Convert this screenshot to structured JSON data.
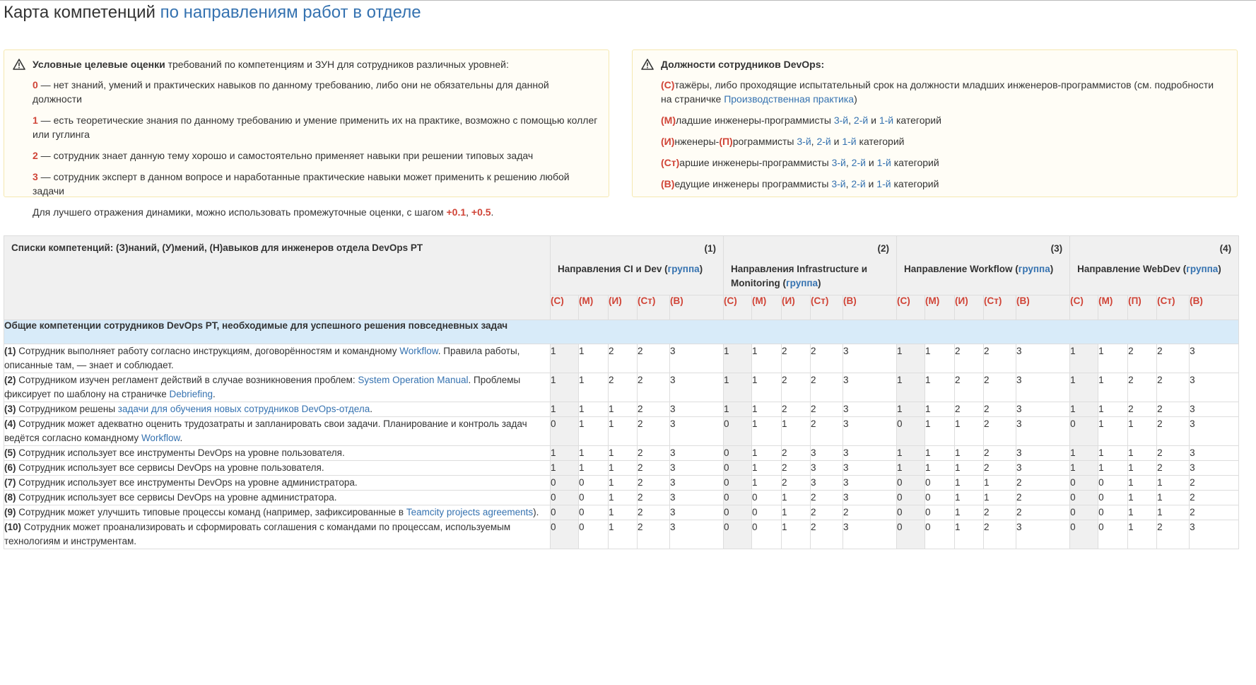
{
  "page": {
    "title_prefix": "Карта компетенций",
    "title_link": "по направлениям работ в отделе"
  },
  "colors": {
    "link": "#3572b0",
    "accent_red": "#d04437",
    "panel_bg": "#fffdf6",
    "section_bg": "#d8ebf9",
    "header_bg": "#f0f0f0"
  },
  "left_panel": {
    "icon": "warning-icon",
    "head_bold": "Условные целевые оценки",
    "head_rest": " требований по компетенциям и ЗУН для сотрудников различных уровней:",
    "levels": [
      {
        "score": "0",
        "text": " — нет знаний, умений и практических навыков по данному требованию, либо они не обязательны для данной должности"
      },
      {
        "score": "1",
        "text": " — есть теоретические знания по данному требованию и умение применить их на практике, возможно с помощью коллег или гуглинга"
      },
      {
        "score": "2",
        "text": " — сотрудник знает данную тему хорошо и самостоятельно применяет навыки при решении типовых задач"
      },
      {
        "score": "3",
        "text": " — сотрудник эксперт в данном вопросе и наработанные практические навыки может применить к решению любой задачи"
      }
    ],
    "note_text": "Для лучшего отражения динамики, можно использовать промежуточные оценки, с шагом ",
    "note_step1": "+0.1",
    "note_sep": ", ",
    "note_step2": "+0.5",
    "note_end": "."
  },
  "right_panel": {
    "icon": "warning-icon",
    "head": "Должности сотрудников DevOps:",
    "intern": {
      "code": "(С)",
      "text": "тажёры, либо проходящие испытательный срок на должности младших инженеров-программистов (см. подробности на страничке ",
      "link": "Производственная практика",
      "end": ")"
    },
    "positions": [
      {
        "code": "(М)",
        "code2": "",
        "mid": "",
        "text": "ладшие инженеры-программисты "
      },
      {
        "code": "(И)",
        "code2": "(П)",
        "mid": "нженеры-",
        "text": "рограммисты "
      },
      {
        "code": "(Ст)",
        "code2": "",
        "mid": "",
        "text": "аршие инженеры-программисты "
      },
      {
        "code": "(В)",
        "code2": "",
        "mid": "",
        "text": "едущие инженеры программисты "
      }
    ],
    "cat3": "3-й",
    "cat2": "2-й",
    "cat1": "1-й",
    "comma": ", ",
    "and": " и ",
    "category": " категорий"
  },
  "table": {
    "list_header": "Списки компетенций: (З)наний, (У)мений, (Н)авыков для инженеров отдела DevOps PT",
    "group_link": "группа",
    "directions": [
      {
        "num": "(1)",
        "name": "Направления CI и Dev (",
        "close": ")"
      },
      {
        "num": "(2)",
        "name": "Направления Infrastructure и Monitoring (",
        "close": ")"
      },
      {
        "num": "(3)",
        "name": "Направление Workflow (",
        "close": ")"
      },
      {
        "num": "(4)",
        "name": "Направление WebDev (",
        "close": ")"
      }
    ],
    "levels": [
      [
        "(С)",
        "(М)",
        "(И)",
        "(Ст)",
        "(В)"
      ],
      [
        "(С)",
        "(М)",
        "(И)",
        "(Ст)",
        "(В)"
      ],
      [
        "(С)",
        "(М)",
        "(И)",
        "(Ст)",
        "(В)"
      ],
      [
        "(С)",
        "(М)",
        "(П)",
        "(Ст)",
        "(В)"
      ]
    ],
    "section_title": "Общие компетенции сотрудников DevOps PT, необходимые для успешного решения повседневных задач",
    "rows": [
      {
        "n": "(1)",
        "t1": " Сотрудник выполняет работу согласно инструкциям, договорённостям и командному ",
        "l1": "Workflow",
        "t2": ". Правила работы, описанные там, — знает и соблюдает.",
        "l2": "",
        "t3": "",
        "v": [
          [
            "1",
            "1",
            "2",
            "2",
            "3"
          ],
          [
            "1",
            "1",
            "2",
            "2",
            "3"
          ],
          [
            "1",
            "1",
            "2",
            "2",
            "3"
          ],
          [
            "1",
            "1",
            "2",
            "2",
            "3"
          ]
        ]
      },
      {
        "n": "(2)",
        "t1": " Сотрудником изучен регламент действий в случае возникновения проблем: ",
        "l1": "System Operation Manual",
        "t2": ". Проблемы фиксирует по шаблону на страничке ",
        "l2": "Debriefing",
        "t3": ".",
        "v": [
          [
            "1",
            "1",
            "2",
            "2",
            "3"
          ],
          [
            "1",
            "1",
            "2",
            "2",
            "3"
          ],
          [
            "1",
            "1",
            "2",
            "2",
            "3"
          ],
          [
            "1",
            "1",
            "2",
            "2",
            "3"
          ]
        ]
      },
      {
        "n": "(3)",
        "t1": " Сотрудником решены ",
        "l1": "задачи для обучения новых сотрудников DevOps-отдела",
        "t2": ".",
        "l2": "",
        "t3": "",
        "v": [
          [
            "1",
            "1",
            "1",
            "2",
            "3"
          ],
          [
            "1",
            "1",
            "2",
            "2",
            "3"
          ],
          [
            "1",
            "1",
            "2",
            "2",
            "3"
          ],
          [
            "1",
            "1",
            "2",
            "2",
            "3"
          ]
        ]
      },
      {
        "n": "(4)",
        "t1": " Сотрудник может адекватно оценить трудозатраты и запланировать свои задачи. Планирование и контроль задач ведётся согласно командному ",
        "l1": "Workflow",
        "t2": ".",
        "l2": "",
        "t3": "",
        "v": [
          [
            "0",
            "1",
            "1",
            "2",
            "3"
          ],
          [
            "0",
            "1",
            "1",
            "2",
            "3"
          ],
          [
            "0",
            "1",
            "1",
            "2",
            "3"
          ],
          [
            "0",
            "1",
            "1",
            "2",
            "3"
          ]
        ]
      },
      {
        "n": "(5)",
        "t1": " Сотрудник использует все инструменты DevOps на уровне пользователя.",
        "l1": "",
        "t2": "",
        "l2": "",
        "t3": "",
        "v": [
          [
            "1",
            "1",
            "1",
            "2",
            "3"
          ],
          [
            "0",
            "1",
            "2",
            "3",
            "3"
          ],
          [
            "1",
            "1",
            "1",
            "2",
            "3"
          ],
          [
            "1",
            "1",
            "1",
            "2",
            "3"
          ]
        ]
      },
      {
        "n": "(6)",
        "t1": " Сотрудник использует все сервисы DevOps на уровне пользователя.",
        "l1": "",
        "t2": "",
        "l2": "",
        "t3": "",
        "v": [
          [
            "1",
            "1",
            "1",
            "2",
            "3"
          ],
          [
            "0",
            "1",
            "2",
            "3",
            "3"
          ],
          [
            "1",
            "1",
            "1",
            "2",
            "3"
          ],
          [
            "1",
            "1",
            "1",
            "2",
            "3"
          ]
        ]
      },
      {
        "n": "(7)",
        "t1": " Сотрудник использует все инструменты DevOps на уровне администратора.",
        "l1": "",
        "t2": "",
        "l2": "",
        "t3": "",
        "v": [
          [
            "0",
            "0",
            "1",
            "2",
            "3"
          ],
          [
            "0",
            "1",
            "2",
            "3",
            "3"
          ],
          [
            "0",
            "0",
            "1",
            "1",
            "2"
          ],
          [
            "0",
            "0",
            "1",
            "1",
            "2"
          ]
        ]
      },
      {
        "n": "(8)",
        "t1": " Сотрудник использует все сервисы DevOps на уровне администратора.",
        "l1": "",
        "t2": "",
        "l2": "",
        "t3": "",
        "v": [
          [
            "0",
            "0",
            "1",
            "2",
            "3"
          ],
          [
            "0",
            "0",
            "1",
            "2",
            "3"
          ],
          [
            "0",
            "0",
            "1",
            "1",
            "2"
          ],
          [
            "0",
            "0",
            "1",
            "1",
            "2"
          ]
        ]
      },
      {
        "n": "(9)",
        "t1": " Сотрудник может улучшить типовые процессы команд (например, зафиксированные в ",
        "l1": "Teamcity projects agreements",
        "t2": ").",
        "l2": "",
        "t3": "",
        "v": [
          [
            "0",
            "0",
            "1",
            "2",
            "3"
          ],
          [
            "0",
            "0",
            "1",
            "2",
            "2"
          ],
          [
            "0",
            "0",
            "1",
            "2",
            "2"
          ],
          [
            "0",
            "0",
            "1",
            "1",
            "2"
          ]
        ]
      },
      {
        "n": "(10)",
        "t1": " Сотрудник может проанализировать и сформировать соглашения с командами по процессам, используемым технологиям и инструментам.",
        "l1": "",
        "t2": "",
        "l2": "",
        "t3": "",
        "v": [
          [
            "0",
            "0",
            "1",
            "2",
            "3"
          ],
          [
            "0",
            "0",
            "1",
            "2",
            "3"
          ],
          [
            "0",
            "0",
            "1",
            "2",
            "3"
          ],
          [
            "0",
            "0",
            "1",
            "2",
            "3"
          ]
        ]
      }
    ]
  }
}
